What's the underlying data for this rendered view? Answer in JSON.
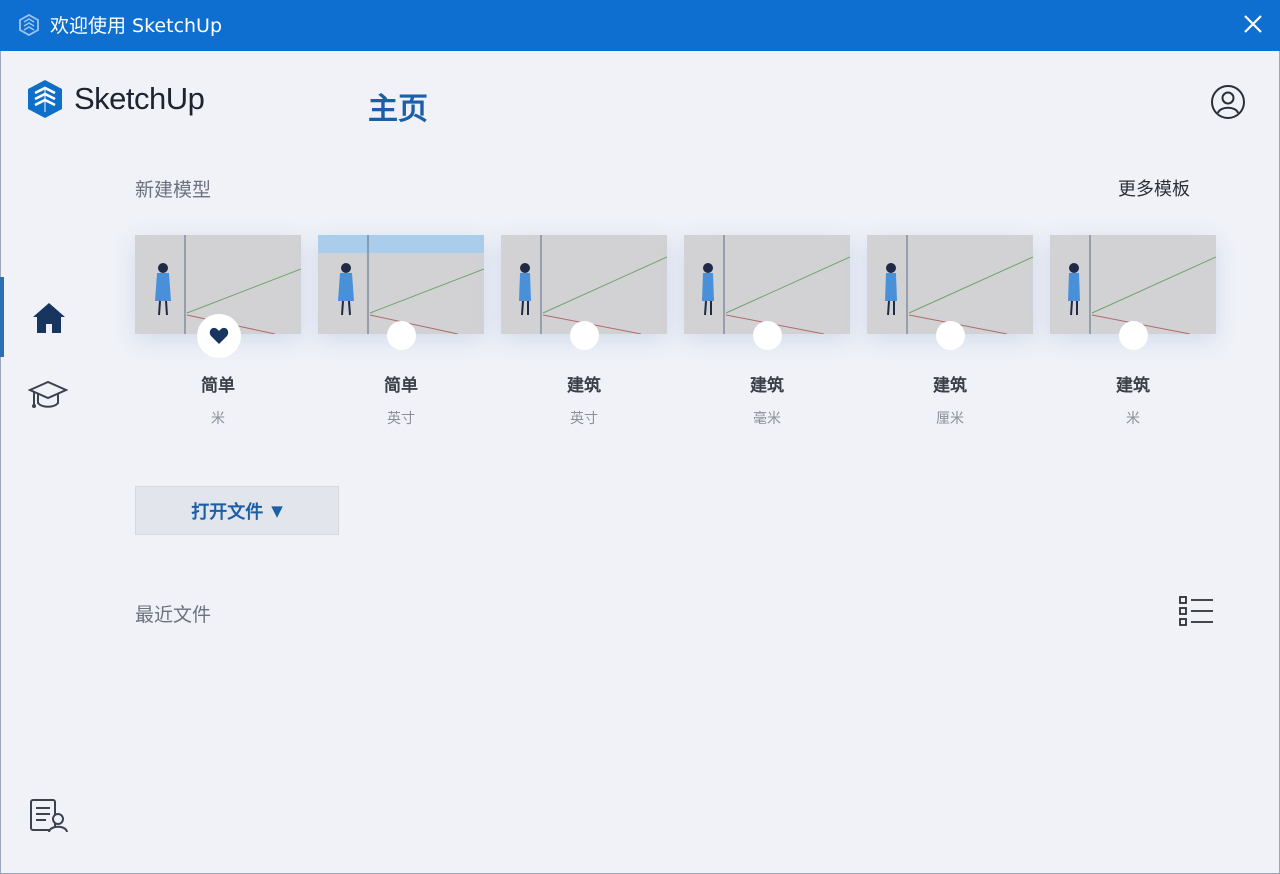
{
  "window": {
    "title": "欢迎使用 SketchUp",
    "icons": {
      "app": "sketchup-app-icon",
      "close": "close-icon"
    }
  },
  "header": {
    "logo_text": "SketchUp",
    "page_title": "主页",
    "user_icon": "user-account-icon"
  },
  "sidebar": {
    "items": [
      {
        "icon": "home-icon",
        "active": true
      },
      {
        "icon": "graduation-cap-icon",
        "active": false
      },
      {
        "icon": "document-user-icon",
        "active": false
      }
    ]
  },
  "new_model": {
    "label": "新建模型",
    "more_templates": "更多模板",
    "templates": [
      {
        "name": "简单",
        "unit": "米",
        "favorite": true,
        "sky": false
      },
      {
        "name": "简单",
        "unit": "英寸",
        "favorite": false,
        "sky": true
      },
      {
        "name": "建筑",
        "unit": "英寸",
        "favorite": false,
        "sky": false
      },
      {
        "name": "建筑",
        "unit": "毫米",
        "favorite": false,
        "sky": false
      },
      {
        "name": "建筑",
        "unit": "厘米",
        "favorite": false,
        "sky": false
      },
      {
        "name": "建筑",
        "unit": "米",
        "favorite": false,
        "sky": false
      }
    ]
  },
  "open_file": {
    "label": "打开文件",
    "caret": "▼"
  },
  "recent": {
    "label": "最近文件",
    "view_icon": "list-view-icon"
  },
  "colors": {
    "titlebar": "#0e6fd1",
    "accent": "#1a5fa8",
    "background": "#f0f2f8"
  }
}
